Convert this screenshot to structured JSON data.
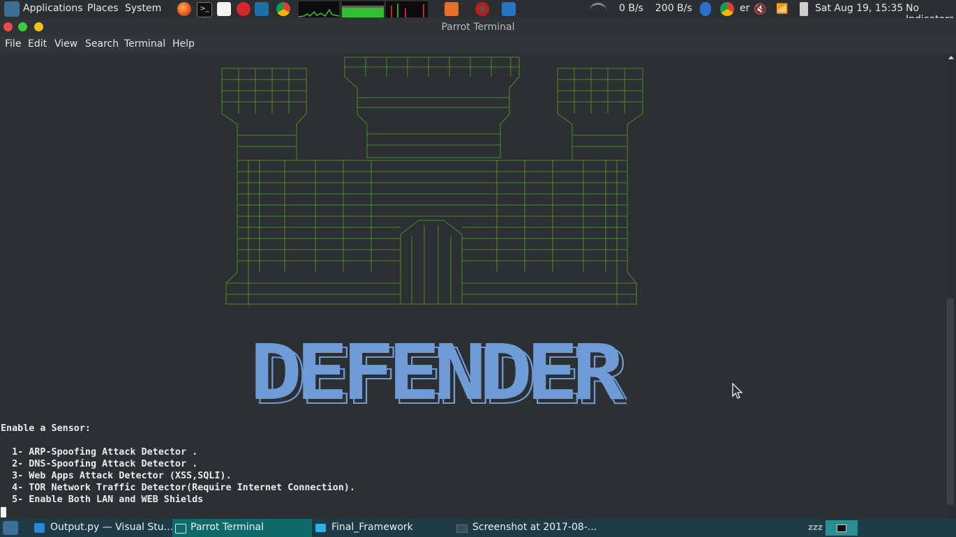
{
  "top_panel": {
    "menus": [
      "Applications",
      "Places",
      "System"
    ],
    "launchers": [
      "firefox-icon",
      "terminal-icon",
      "text-editor-icon",
      "burp-icon",
      "wireshark-icon",
      "chrome-icon"
    ],
    "tray_apps": [
      "burpsuite-icon",
      "armitage-icon",
      "vscode-icon"
    ],
    "net_down": "0 B/s",
    "net_up": "200 B/s",
    "chrome_truncated": "er",
    "datetime": "Sat Aug 19, 15:35",
    "indicators": "No Indicators"
  },
  "window": {
    "title": "Parrot Terminal",
    "menu": [
      "File",
      "Edit",
      "View",
      "Search",
      "Terminal",
      "Help"
    ]
  },
  "terminal": {
    "banner_text": "DEFENDER",
    "heading": "Enable a Sensor:",
    "options": [
      "  1- ARP-Spoofing Attack Detector .",
      "  2- DNS-Spoofing Attack Detector .",
      "  3- Web Apps Attack Detector (XSS,SQLI).",
      "  4- TOR Network Traffic Detector(Require Internet Connection).",
      "  5- Enable Both LAN and WEB Shields"
    ]
  },
  "taskbar": {
    "tasks": [
      {
        "label": "Output.py — Visual Stu...",
        "icon": "vscode-icon"
      },
      {
        "label": "Parrot Terminal",
        "icon": "terminal-icon"
      },
      {
        "label": "Final_Framework",
        "icon": "folder-icon"
      },
      {
        "label": "Screenshot at 2017-08-...",
        "icon": "image-icon"
      }
    ],
    "sleep_indicator": "zzz"
  },
  "colors": {
    "ascii_castle": "#4f8a2a",
    "banner": "#6f9bd6",
    "terminal_bg": "#2c3033",
    "taskbar_bg": "#1e3a47"
  }
}
